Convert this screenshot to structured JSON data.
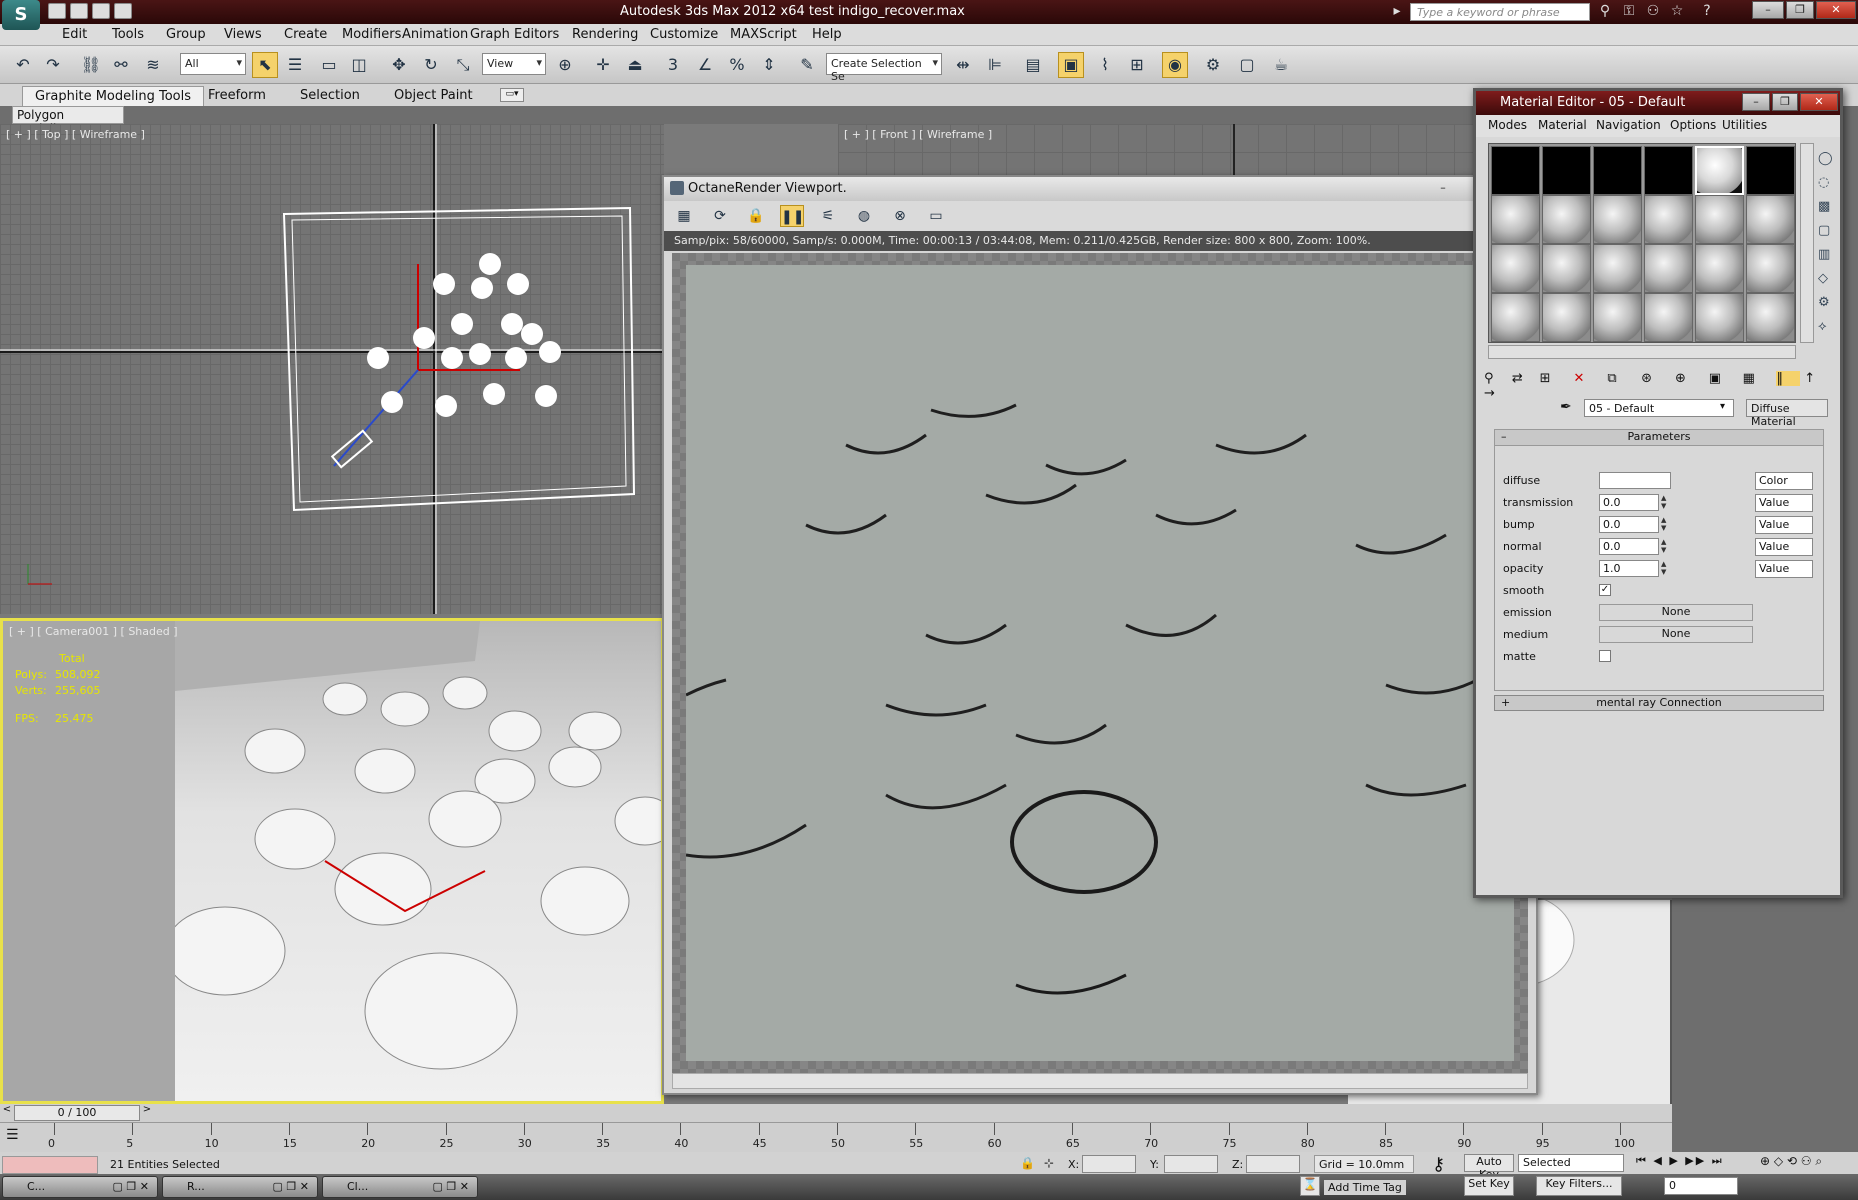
{
  "titlebar": {
    "app_logo": "S",
    "title": "Autodesk 3ds Max  2012 x64      test indigo_recover.max",
    "search_placeholder": "Type a keyword or phrase"
  },
  "menubar": [
    "Edit",
    "Tools",
    "Group",
    "Views",
    "Create",
    "Modifiers",
    "Animation",
    "Graph Editors",
    "Rendering",
    "Customize",
    "MAXScript",
    "Help"
  ],
  "toolbar": {
    "filter": "All",
    "coord": "View",
    "selection_set": "Create Selection Se",
    "snap_label": "3"
  },
  "ribbon": {
    "tabs": [
      "Graphite Modeling Tools",
      "Freeform",
      "Selection",
      "Object Paint"
    ],
    "sub": "Polygon Modeling"
  },
  "viewports": {
    "top": "[ + ] [ Top ] [ Wireframe ]",
    "front": "[ + ] [ Front ] [ Wireframe ]",
    "camera": "[ + ] [ Camera001 ] [ Shaded ]",
    "stats": {
      "total": "Total",
      "polys_label": "Polys:",
      "polys": "508,092",
      "verts_label": "Verts:",
      "verts": "255,605",
      "fps_label": "FPS:",
      "fps": "25.475"
    }
  },
  "octane": {
    "title": "OctaneRender Viewport.",
    "status": "Samp/pix: 58/60000,   Samp/s: 0.000M,   Time: 00:00:13 / 03:44:08,   Mem: 0.211/0.425GB,   Render size: 800 x 800,   Zoom: 100%."
  },
  "material_editor": {
    "title": "Material Editor - 05 - Default",
    "menu": [
      "Modes",
      "Material",
      "Navigation",
      "Options",
      "Utilities"
    ],
    "name": "05 - Default",
    "type": "Diffuse Material",
    "params_title": "Parameters",
    "params": [
      {
        "label": "diffuse",
        "value": "",
        "mode": "Color"
      },
      {
        "label": "transmission",
        "value": "0.0",
        "mode": "Value"
      },
      {
        "label": "bump",
        "value": "0.0",
        "mode": "Value"
      },
      {
        "label": "normal",
        "value": "0.0",
        "mode": "Value"
      },
      {
        "label": "opacity",
        "value": "1.0",
        "mode": "Value"
      }
    ],
    "smooth_label": "smooth",
    "emission_label": "emission",
    "emission_value": "None",
    "medium_label": "medium",
    "medium_value": "None",
    "matte_label": "matte",
    "mental_ray": "mental ray Connection"
  },
  "timeline": {
    "frame": "0 / 100",
    "ticks": [
      "0",
      "5",
      "10",
      "15",
      "20",
      "25",
      "30",
      "35",
      "40",
      "45",
      "50",
      "55",
      "60",
      "65",
      "70",
      "75",
      "80",
      "85",
      "90",
      "95",
      "100"
    ]
  },
  "status": {
    "selected": "21 Entities Selected",
    "x_label": "X:",
    "y_label": "Y:",
    "z_label": "Z:",
    "grid": "Grid = 10.0mm",
    "add_time_tag": "Add Time Tag",
    "auto_key": "Auto Key",
    "set_key": "Set Key",
    "selected_dd": "Selected",
    "key_filters": "Key Filters...",
    "frame_field": "0"
  },
  "taskbar": [
    "C...",
    "R...",
    "Cl..."
  ],
  "colors": {
    "title_bg": "#4a1515",
    "active_tool": "#f5d26b",
    "camera_border": "#e8e14a"
  }
}
